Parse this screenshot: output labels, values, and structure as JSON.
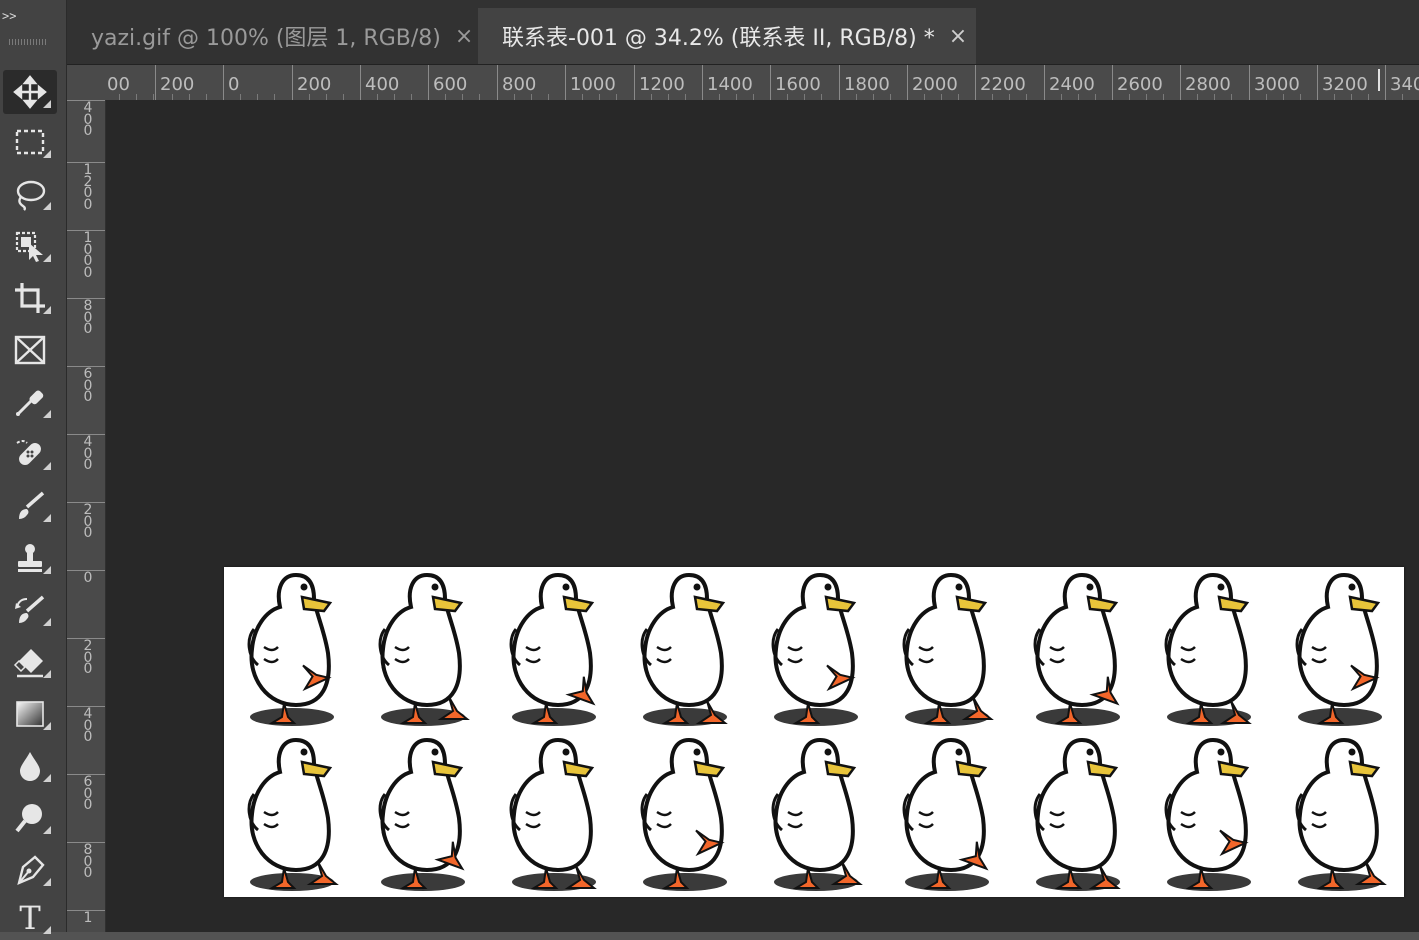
{
  "app": "Photoshop",
  "toolbar": {
    "expand_label": ">>",
    "tools": [
      {
        "id": "move",
        "icon": "move-icon",
        "active": true
      },
      {
        "id": "marquee",
        "icon": "rectangular-marquee-icon"
      },
      {
        "id": "lasso",
        "icon": "lasso-icon"
      },
      {
        "id": "object-select",
        "icon": "object-selection-icon"
      },
      {
        "id": "crop",
        "icon": "crop-icon"
      },
      {
        "id": "frame",
        "icon": "frame-icon"
      },
      {
        "id": "eyedropper",
        "icon": "eyedropper-icon"
      },
      {
        "id": "healing",
        "icon": "healing-brush-icon"
      },
      {
        "id": "brush",
        "icon": "brush-icon"
      },
      {
        "id": "stamp",
        "icon": "clone-stamp-icon"
      },
      {
        "id": "history-brush",
        "icon": "history-brush-icon"
      },
      {
        "id": "eraser",
        "icon": "eraser-icon"
      },
      {
        "id": "gradient",
        "icon": "gradient-icon"
      },
      {
        "id": "blur",
        "icon": "blur-icon"
      },
      {
        "id": "dodge",
        "icon": "dodge-icon"
      },
      {
        "id": "pen",
        "icon": "pen-icon"
      },
      {
        "id": "type",
        "icon": "type-icon",
        "label": "T"
      }
    ]
  },
  "tabs": [
    {
      "label": "yazi.gif @ 100% (图层 1, RGB/8)",
      "close": "×",
      "active": false
    },
    {
      "label": "联系表-001 @ 34.2% (联系表 II, RGB/8) *",
      "close": "×",
      "active": true
    }
  ],
  "ruler_h": [
    "00",
    "200",
    "0",
    "200",
    "400",
    "600",
    "800",
    "1000",
    "1200",
    "1400",
    "1600",
    "1800",
    "2000",
    "2200",
    "2400",
    "2600",
    "2800",
    "3000",
    "3200",
    "340"
  ],
  "ruler_v": [
    "4\n0\n0",
    "1\n2\n0\n0",
    "1\n0\n0\n0",
    "8\n0\n0",
    "6\n0\n0",
    "4\n0\n0",
    "2\n0\n0",
    "0",
    "2\n0\n0",
    "4\n0\n0",
    "6\n0\n0",
    "8\n0\n0",
    "1"
  ],
  "document": {
    "background": "#ffffff",
    "rows": 2,
    "cols": 9,
    "frame_count": 18
  },
  "colors": {
    "canvas_bg": "#282828",
    "panel": "#434343",
    "tab_bar": "#323232",
    "ruler": "#4a4a4a",
    "duck_beak": "#e8c43a",
    "duck_feet": "#f2662a"
  }
}
